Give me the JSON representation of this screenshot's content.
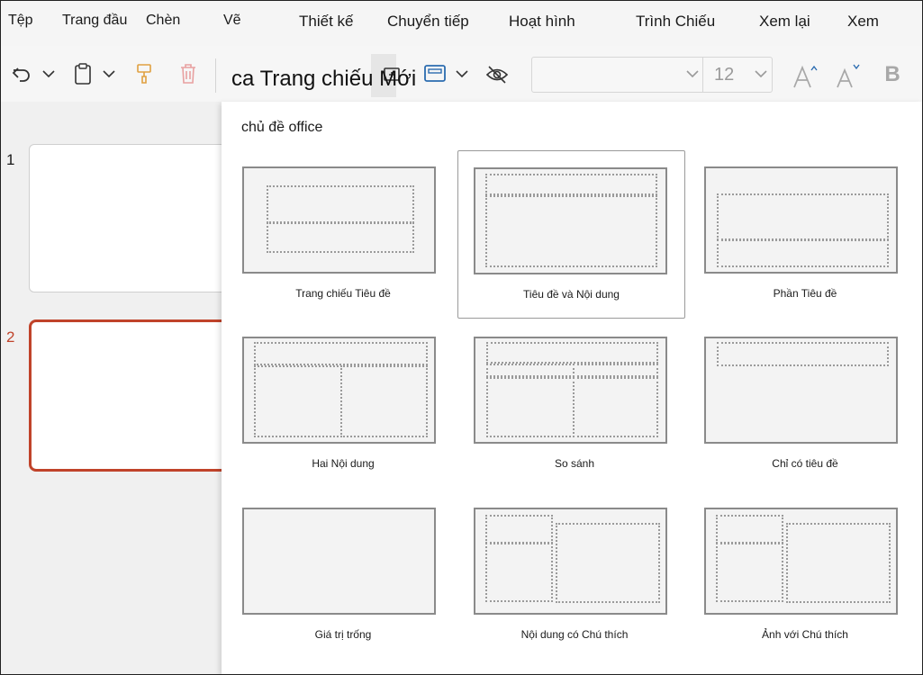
{
  "menu": {
    "file": "Tệp",
    "home": "Trang đầu",
    "insert": "Chèn",
    "draw": "Vẽ",
    "design": "Thiết kế",
    "transitions": "Chuyển tiếp",
    "animations": "Hoạt hình",
    "slideshow": "Trình Chiếu",
    "review": "Xem lại",
    "view": "Xem"
  },
  "toolbar": {
    "new_slide_label": "ca Trang chiếu Mới",
    "font_size": "12"
  },
  "slides": {
    "items": [
      {
        "number": "1",
        "selected": false
      },
      {
        "number": "2",
        "selected": true
      }
    ]
  },
  "gallery": {
    "title": "chủ đề office",
    "layouts": [
      {
        "label": "Trang chiếu Tiêu đề",
        "icon": "title-slide-layout"
      },
      {
        "label": "Tiêu đề và Nội dung",
        "icon": "title-content-layout",
        "selected": true
      },
      {
        "label": "Phần    Tiêu đề",
        "icon": "section-header-layout"
      },
      {
        "label": "Hai Nội dung",
        "icon": "two-content-layout"
      },
      {
        "label": "So sánh",
        "icon": "comparison-layout"
      },
      {
        "label": "Chỉ có tiêu đề",
        "icon": "title-only-layout"
      },
      {
        "label": "Giá trị trống",
        "icon": "blank-layout"
      },
      {
        "label": "Nội dung có Chú thích",
        "icon": "content-caption-layout"
      },
      {
        "label": "Ảnh với Chú thích",
        "icon": "picture-caption-layout"
      }
    ]
  },
  "colors": {
    "accent": "#c0432a",
    "panel_bg": "#f0f0f0",
    "gallery_bg": "#ffffff"
  }
}
